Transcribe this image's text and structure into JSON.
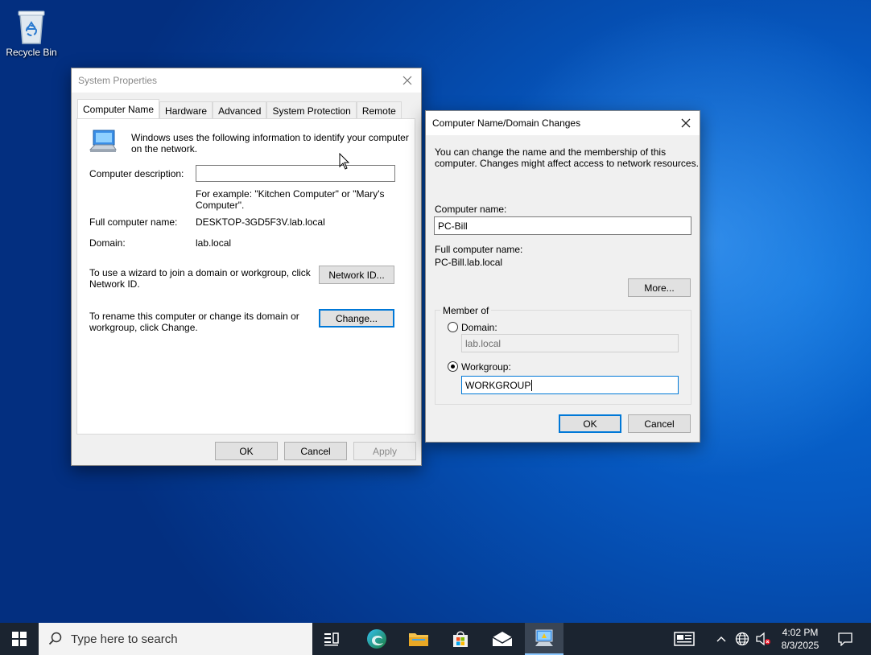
{
  "desktop": {
    "recycle_bin_label": "Recycle Bin"
  },
  "system_properties": {
    "title": "System Properties",
    "tabs": [
      {
        "label": "Computer Name",
        "active": true
      },
      {
        "label": "Hardware",
        "active": false
      },
      {
        "label": "Advanced",
        "active": false
      },
      {
        "label": "System Protection",
        "active": false
      },
      {
        "label": "Remote",
        "active": false
      }
    ],
    "intro_line1": "Windows uses the following information to identify your computer",
    "intro_line2": "on the network.",
    "description_label": "Computer description:",
    "description_value": "",
    "example_line1": "For example: \"Kitchen Computer\" or \"Mary's",
    "example_line2": "Computer\".",
    "full_name_label": "Full computer name:",
    "full_name_value": "DESKTOP-3GD5F3V.lab.local",
    "domain_label": "Domain:",
    "domain_value": "lab.local",
    "wizard_line1": "To use a wizard to join a domain or workgroup, click",
    "wizard_line2": "Network ID.",
    "network_id_button": "Network ID...",
    "rename_line1": "To rename this computer or change its domain or",
    "rename_line2": "workgroup, click Change.",
    "change_button": "Change...",
    "ok_button": "OK",
    "cancel_button": "Cancel",
    "apply_button": "Apply"
  },
  "name_changes": {
    "title": "Computer Name/Domain Changes",
    "intro_line1": "You can change the name and the membership of this",
    "intro_line2": "computer. Changes might affect access to network resources.",
    "computer_name_label": "Computer name:",
    "computer_name_value": "PC-Bill",
    "full_name_label": "Full computer name:",
    "full_name_value": "PC-Bill.lab.local",
    "more_button": "More...",
    "member_of_label": "Member of",
    "domain_label": "Domain:",
    "domain_value": "lab.local",
    "domain_selected": false,
    "workgroup_label": "Workgroup:",
    "workgroup_value": "WORKGROUP",
    "workgroup_selected": true,
    "ok_button": "OK",
    "cancel_button": "Cancel"
  },
  "taskbar": {
    "search_placeholder": "Type here to search",
    "time": "4:02 PM",
    "date": "8/3/2025",
    "accent": "#0078d7"
  }
}
